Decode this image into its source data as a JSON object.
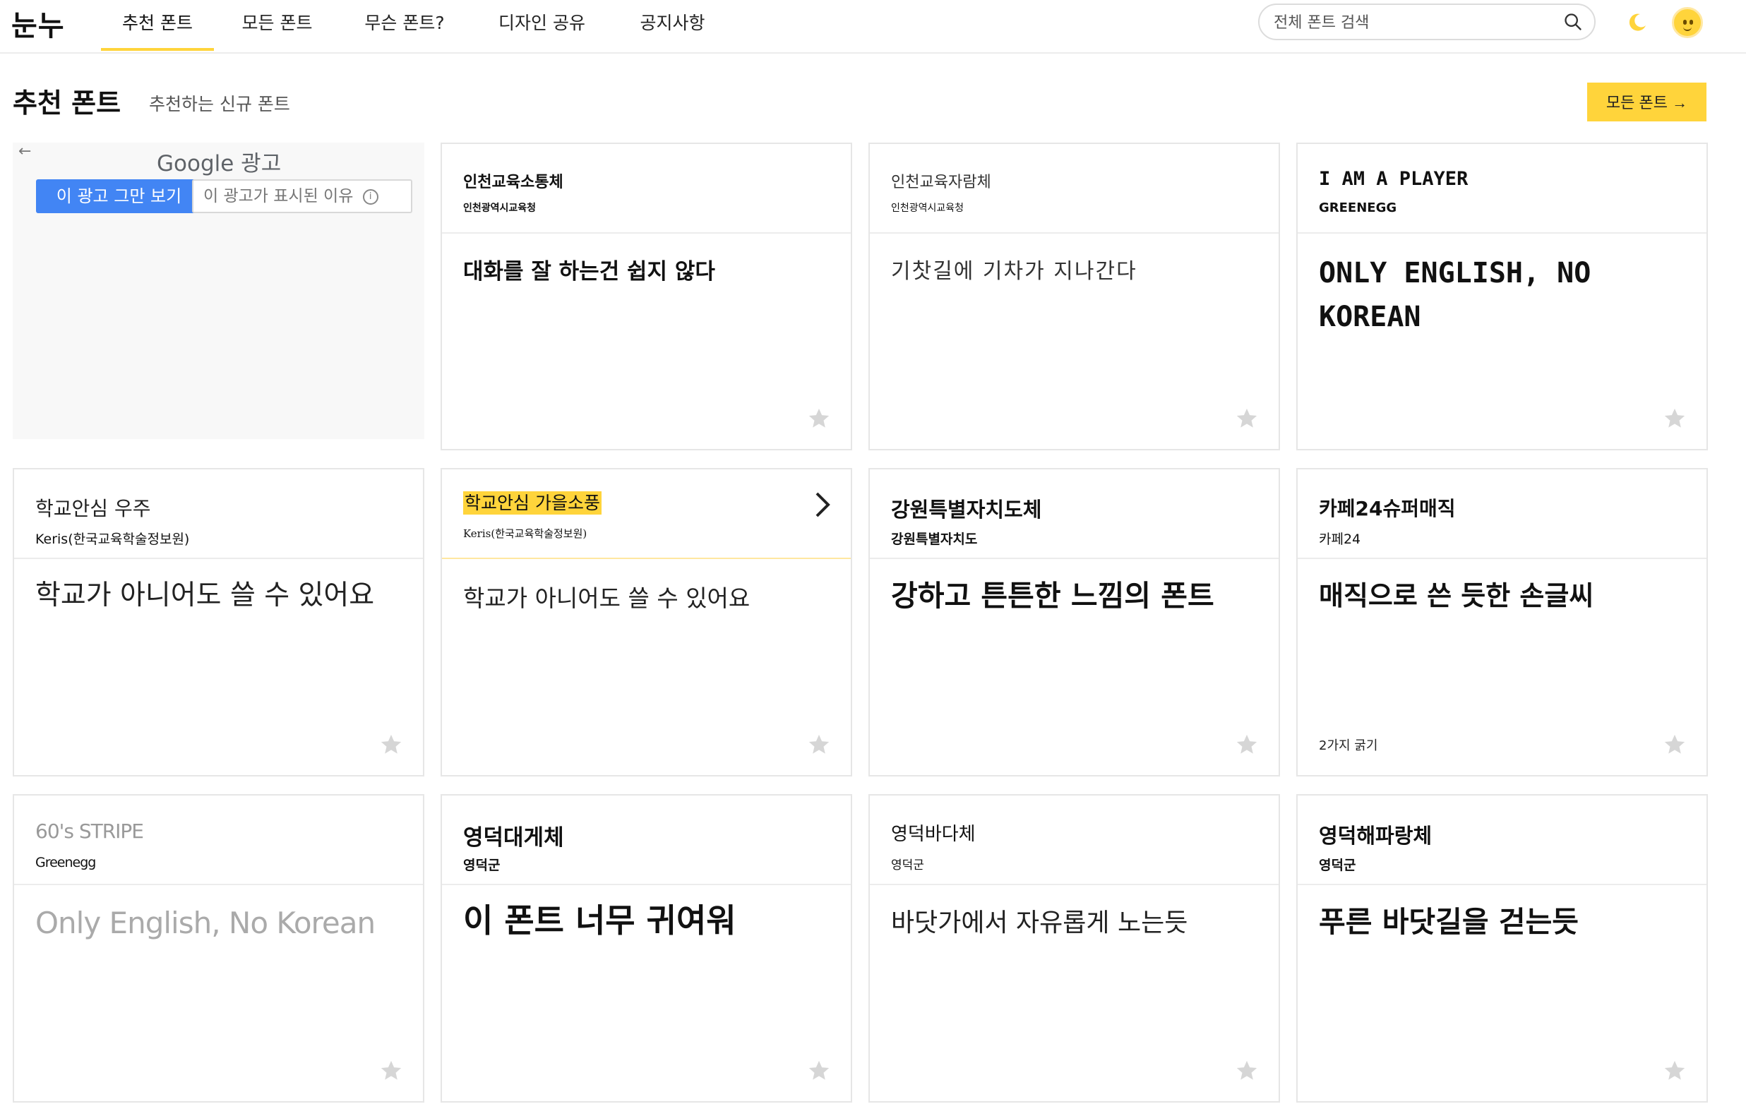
{
  "header": {
    "logo": "눈누",
    "tabs": [
      "추천 폰트",
      "모든 폰트",
      "무슨 폰트?",
      "디자인 공유",
      "공지사항"
    ],
    "search_placeholder": "전체 폰트 검색"
  },
  "section": {
    "title": "추천 폰트",
    "subtitle": "추천하는 신규 폰트",
    "all_button": "모든 폰트 →"
  },
  "ad": {
    "back": "←",
    "google": "Google 광고",
    "stop": "이 광고 그만 보기",
    "why": "이 광고가 표시된 이유",
    "info": "i"
  },
  "cards": [
    {
      "name": "인천교육소통체",
      "maker": "인천광역시교육청",
      "sample": "대화를 잘 하는건 쉽지 않다"
    },
    {
      "name": "인천교육자람체",
      "maker": "인천광역시교육청",
      "sample": "기찻길에 기차가 지나간다"
    },
    {
      "name": "I AM A PLAYER",
      "maker": "GREENEGG",
      "sample": "ONLY ENGLISH, NO KOREAN"
    },
    {
      "name": "학교안심 우주",
      "maker": "Keris(한국교육학술정보원)",
      "sample": "학교가 아니어도 쓸 수 있어요"
    },
    {
      "name": "학교안심 가을소풍",
      "maker": "Keris(한국교육학술정보원)",
      "sample": "학교가 아니어도 쓸 수 있어요"
    },
    {
      "name": "강원특별자치도체",
      "maker": "강원특별자치도",
      "sample": "강하고 튼튼한 느낌의 폰트"
    },
    {
      "name": "카페24슈퍼매직",
      "maker": "카페24",
      "sample": "매직으로 쓴 듯한 손글씨",
      "note": "2가지 굵기"
    },
    {
      "name": "60's STRIPE",
      "maker": "Greenegg",
      "sample": "Only English, No Korean"
    },
    {
      "name": "영덕대게체",
      "maker": "영덕군",
      "sample": "이 폰트 너무 귀여워"
    },
    {
      "name": "영덕바다체",
      "maker": "영덕군",
      "sample": "바닷가에서 자유롭게 노는듯"
    },
    {
      "name": "영덕해파랑체",
      "maker": "영덕군",
      "sample": "푸른 바닷길을 걷는듯"
    }
  ],
  "colors": {
    "accent": "#ffd43b",
    "ad_button": "#4285f4",
    "border": "#e6e6e6"
  },
  "icons": [
    "search-icon",
    "moon-icon",
    "avatar",
    "star-icon",
    "chevron-right-icon"
  ]
}
